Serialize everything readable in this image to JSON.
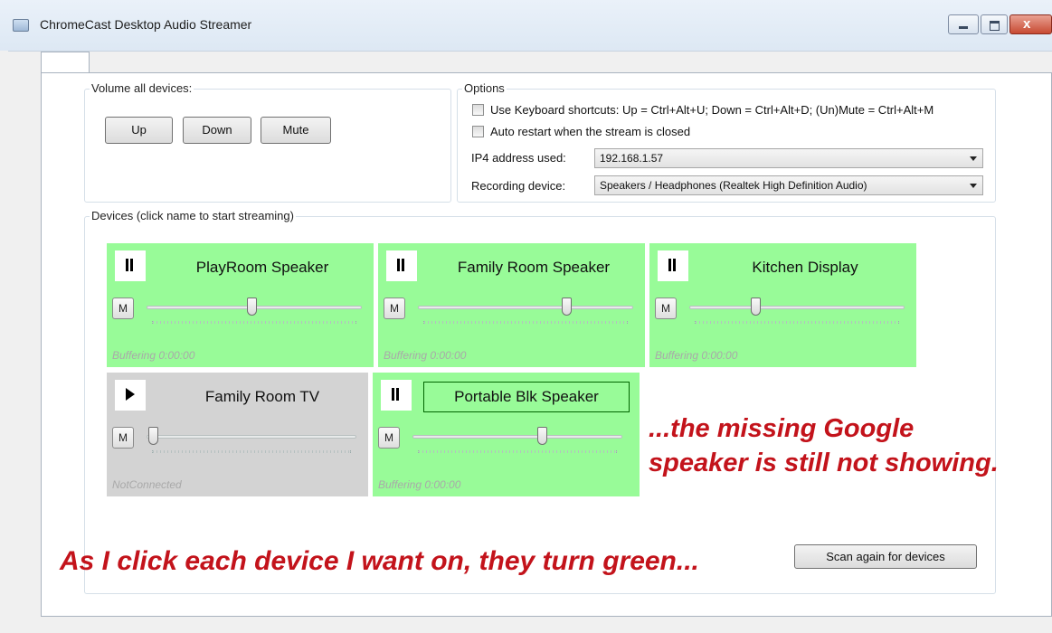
{
  "window": {
    "title": "ChromeCast Desktop Audio Streamer"
  },
  "volume_group": {
    "label": "Volume all devices:",
    "up": "Up",
    "down": "Down",
    "mute": "Mute"
  },
  "options": {
    "label": "Options",
    "keyboard_shortcuts": "Use Keyboard shortcuts: Up = Ctrl+Alt+U; Down = Ctrl+Alt+D; (Un)Mute = Ctrl+Alt+M",
    "auto_restart": "Auto restart when the stream is closed",
    "ip_label": "IP4 address used:",
    "ip_value": "192.168.1.57",
    "recording_label": "Recording device:",
    "recording_value": "Speakers / Headphones (Realtek High Definition Audio)"
  },
  "devices_group": {
    "label": "Devices (click name to start streaming)"
  },
  "devices": [
    {
      "name": "PlayRoom Speaker",
      "state": "pause",
      "mute": "M",
      "status": "Buffering 0:00:00",
      "color": "#98fb98",
      "volume": 0.47
    },
    {
      "name": "Family Room Speaker",
      "state": "pause",
      "mute": "M",
      "status": "Buffering 0:00:00",
      "color": "#98fb98",
      "volume": 0.68
    },
    {
      "name": "Kitchen Display",
      "state": "pause",
      "mute": "M",
      "status": "Buffering 0:00:00",
      "color": "#98fb98",
      "volume": 0.31
    },
    {
      "name": "Family Room TV",
      "state": "play",
      "mute": "M",
      "status": "NotConnected",
      "color": "#d3d3d3",
      "volume": 0.0
    },
    {
      "name": "Portable Blk Speaker",
      "state": "pause",
      "mute": "M",
      "status": "Buffering 0:00:00",
      "color": "#98fb98",
      "volume": 0.6
    }
  ],
  "scan_button": "Scan again for devices",
  "annotations": {
    "missing_line1": "...the missing Google",
    "missing_line2": "speaker is still not showing.",
    "click_note": "As I click each device I want on, they turn green..."
  },
  "accent_colors": {
    "active": "#98fb98",
    "inactive": "#d3d3d3",
    "annotation": "#c3131b"
  }
}
